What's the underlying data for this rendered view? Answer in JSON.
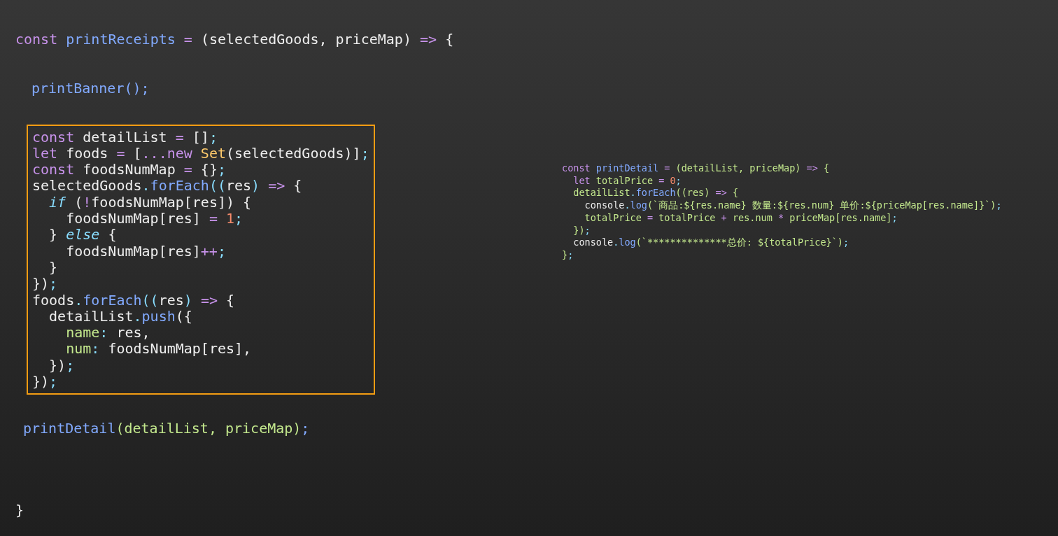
{
  "code_segments": [
    {
      "highlighted": false,
      "lines": [
        [
          {
            "kind": "keyword",
            "text": "const "
          },
          {
            "kind": "function",
            "text": "printReceipts"
          },
          {
            "kind": "keyword",
            "text": " = "
          },
          {
            "kind": "plain",
            "text": "(selectedGoods, priceMap) "
          },
          {
            "kind": "keyword",
            "text": "=>"
          },
          {
            "kind": "plain",
            "text": " {"
          }
        ]
      ]
    },
    {
      "highlighted": false,
      "lines": [
        [
          {
            "kind": "function",
            "text": "printBanner();"
          }
        ]
      ]
    },
    {
      "highlighted": true,
      "lines": [
        [
          {
            "kind": "keyword",
            "text": "const "
          },
          {
            "kind": "plain",
            "text": "detailList "
          },
          {
            "kind": "keyword",
            "text": "="
          },
          {
            "kind": "plain",
            "text": " []"
          },
          {
            "kind": "punct",
            "text": ";"
          }
        ],
        [
          {
            "kind": "keyword",
            "text": "let "
          },
          {
            "kind": "plain",
            "text": "foods "
          },
          {
            "kind": "keyword",
            "text": "="
          },
          {
            "kind": "plain",
            "text": " ["
          },
          {
            "kind": "keyword",
            "text": "...new "
          },
          {
            "kind": "class",
            "text": "Set"
          },
          {
            "kind": "plain",
            "text": "(selectedGoods)]"
          },
          {
            "kind": "punct",
            "text": ";"
          }
        ],
        [
          {
            "kind": "keyword",
            "text": "const "
          },
          {
            "kind": "plain",
            "text": "foodsNumMap "
          },
          {
            "kind": "keyword",
            "text": "="
          },
          {
            "kind": "plain",
            "text": " {}"
          },
          {
            "kind": "punct",
            "text": ";"
          }
        ],
        [
          {
            "kind": "plain",
            "text": "selectedGoods"
          },
          {
            "kind": "punct",
            "text": "."
          },
          {
            "kind": "function",
            "text": "forEach"
          },
          {
            "kind": "punct",
            "text": "(("
          },
          {
            "kind": "plain",
            "text": "res"
          },
          {
            "kind": "punct",
            "text": ") "
          },
          {
            "kind": "keyword",
            "text": "=>"
          },
          {
            "kind": "plain",
            "text": " {"
          }
        ],
        [
          {
            "kind": "control",
            "text": "  if"
          },
          {
            "kind": "plain",
            "text": " ("
          },
          {
            "kind": "keyword",
            "text": "!"
          },
          {
            "kind": "plain",
            "text": "foodsNumMap[res]) {"
          }
        ],
        [
          {
            "kind": "plain",
            "text": "    foodsNumMap[res] "
          },
          {
            "kind": "keyword",
            "text": "= "
          },
          {
            "kind": "number",
            "text": "1"
          },
          {
            "kind": "punct",
            "text": ";"
          }
        ],
        [
          {
            "kind": "plain",
            "text": "  } "
          },
          {
            "kind": "control",
            "text": "else"
          },
          {
            "kind": "plain",
            "text": " {"
          }
        ],
        [
          {
            "kind": "plain",
            "text": "    foodsNumMap[res]"
          },
          {
            "kind": "keyword",
            "text": "++"
          },
          {
            "kind": "punct",
            "text": ";"
          }
        ],
        [
          {
            "kind": "plain",
            "text": "  }"
          }
        ],
        [
          {
            "kind": "plain",
            "text": "})"
          },
          {
            "kind": "punct",
            "text": ";"
          }
        ],
        [
          {
            "kind": "plain",
            "text": "foods"
          },
          {
            "kind": "punct",
            "text": "."
          },
          {
            "kind": "function",
            "text": "forEach"
          },
          {
            "kind": "punct",
            "text": "(("
          },
          {
            "kind": "plain",
            "text": "res"
          },
          {
            "kind": "punct",
            "text": ") "
          },
          {
            "kind": "keyword",
            "text": "=>"
          },
          {
            "kind": "plain",
            "text": " {"
          }
        ],
        [
          {
            "kind": "plain",
            "text": "  detailList"
          },
          {
            "kind": "punct",
            "text": "."
          },
          {
            "kind": "function",
            "text": "push"
          },
          {
            "kind": "plain",
            "text": "({"
          }
        ],
        [
          {
            "kind": "green",
            "text": "    name"
          },
          {
            "kind": "punct",
            "text": ":"
          },
          {
            "kind": "plain",
            "text": " res,"
          }
        ],
        [
          {
            "kind": "green",
            "text": "    num"
          },
          {
            "kind": "punct",
            "text": ":"
          },
          {
            "kind": "plain",
            "text": " foodsNumMap[res],"
          }
        ],
        [
          {
            "kind": "plain",
            "text": "  })"
          },
          {
            "kind": "punct",
            "text": ";"
          }
        ],
        [
          {
            "kind": "plain",
            "text": "})"
          },
          {
            "kind": "punct",
            "text": ";"
          }
        ]
      ]
    },
    {
      "highlighted": false,
      "lines": [
        [
          {
            "kind": "function",
            "text": "printDetail"
          },
          {
            "kind": "green",
            "text": "(detailList, priceMap)"
          },
          {
            "kind": "function",
            "text": ";"
          }
        ]
      ]
    },
    {
      "highlighted": false,
      "lines": [
        [
          {
            "kind": "plain",
            "text": "}"
          }
        ]
      ]
    }
  ],
  "snippet_lines": [
    [
      {
        "kind": "keyword",
        "text": "const "
      },
      {
        "kind": "function",
        "text": "printDetail"
      },
      {
        "kind": "keyword",
        "text": " = "
      },
      {
        "kind": "green",
        "text": "(detailList, priceMap) "
      },
      {
        "kind": "keyword",
        "text": "=>"
      },
      {
        "kind": "green",
        "text": " {"
      }
    ],
    [
      {
        "kind": "keyword",
        "text": "  let "
      },
      {
        "kind": "green",
        "text": "totalPrice "
      },
      {
        "kind": "keyword",
        "text": "= "
      },
      {
        "kind": "number",
        "text": "0"
      },
      {
        "kind": "punct",
        "text": ";"
      }
    ],
    [
      {
        "kind": "green",
        "text": "  detailList"
      },
      {
        "kind": "punct",
        "text": "."
      },
      {
        "kind": "function",
        "text": "forEach"
      },
      {
        "kind": "green",
        "text": "((res) "
      },
      {
        "kind": "keyword",
        "text": "=>"
      },
      {
        "kind": "green",
        "text": " {"
      }
    ],
    [
      {
        "kind": "plain",
        "text": "    console"
      },
      {
        "kind": "punct",
        "text": "."
      },
      {
        "kind": "function",
        "text": "log"
      },
      {
        "kind": "green",
        "text": "(`商品:${res.name} 数量:${res.num} 单价:${priceMap[res.name]}`)"
      },
      {
        "kind": "punct",
        "text": ";"
      }
    ],
    [
      {
        "kind": "green",
        "text": "    totalPrice "
      },
      {
        "kind": "keyword",
        "text": "="
      },
      {
        "kind": "green",
        "text": " totalPrice "
      },
      {
        "kind": "keyword",
        "text": "+"
      },
      {
        "kind": "green",
        "text": " res.num "
      },
      {
        "kind": "keyword",
        "text": "*"
      },
      {
        "kind": "green",
        "text": " priceMap[res.name]"
      },
      {
        "kind": "punct",
        "text": ";"
      }
    ],
    [
      {
        "kind": "green",
        "text": "  })"
      },
      {
        "kind": "punct",
        "text": ";"
      }
    ],
    [
      {
        "kind": "plain",
        "text": "  console"
      },
      {
        "kind": "punct",
        "text": "."
      },
      {
        "kind": "function",
        "text": "log"
      },
      {
        "kind": "green",
        "text": "(`**************总价: ${totalPrice}`)"
      },
      {
        "kind": "punct",
        "text": ";"
      }
    ],
    [
      {
        "kind": "green",
        "text": "}"
      },
      {
        "kind": "punct",
        "text": ";"
      }
    ]
  ]
}
